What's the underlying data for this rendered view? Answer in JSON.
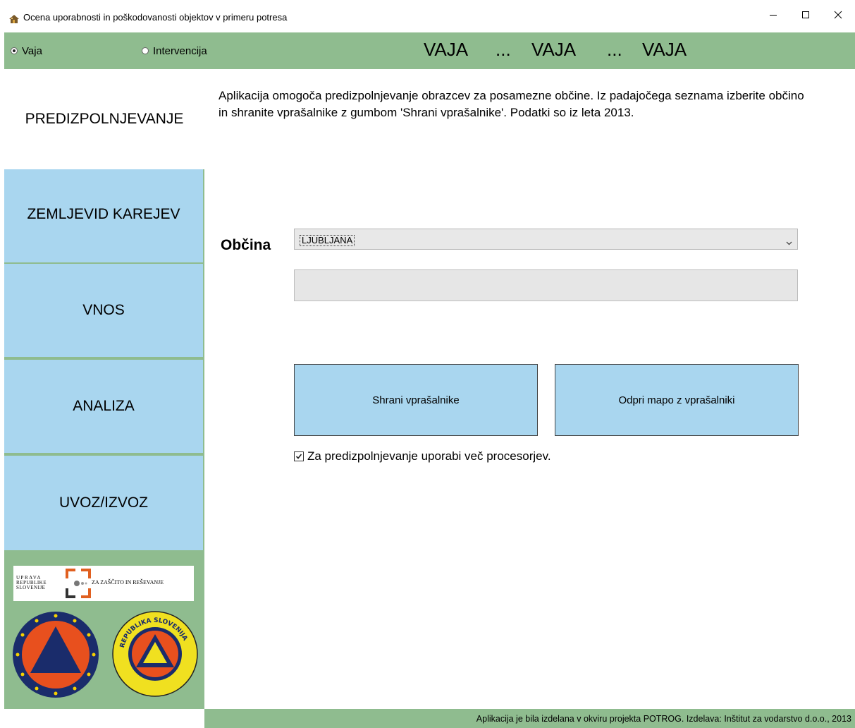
{
  "window": {
    "title": "Ocena uporabnosti in poškodovanosti objektov v primeru potresa",
    "icon": "house-icon",
    "controls": [
      "minimize-icon",
      "maximize-icon",
      "close-icon"
    ]
  },
  "mode": {
    "options": [
      {
        "label": "Vaja",
        "selected": true
      },
      {
        "label": "Intervencija",
        "selected": false
      }
    ],
    "banner": {
      "word": "VAJA",
      "ellipsis": "..."
    }
  },
  "sidebar": {
    "items": [
      {
        "label": "PREDIZPOLNJEVANJE",
        "active": true
      },
      {
        "label": "ZEMLJEVID KAREJEV",
        "active": false
      },
      {
        "label": "VNOS",
        "active": false
      },
      {
        "label": "ANALIZA",
        "active": false
      },
      {
        "label": "UVOZ/IZVOZ",
        "active": false
      }
    ],
    "logo": {
      "line1": "UPRAVA",
      "line2": "REPUBLIKE",
      "line3": "SLOVENIJE",
      "tagline": "ZA ZAŠČITO IN REŠEVANJE"
    },
    "emblem2_text": "REPUBLIKA SLOVENIJA · CIVILNA ZAŠČITA"
  },
  "main": {
    "intro": "Aplikacija omogoča predizpolnjevanje obrazcev za posamezne občine. Iz padajočega seznama izberite občino in shranite vprašalnike z gumbom 'Shrani vprašalnike'. Podatki so iz leta 2013.",
    "municipality_label": "Občina",
    "municipality_value": "LJUBLJANA",
    "progress": 0,
    "save_button": "Shrani vprašalnike",
    "open_button": "Odpri mapo z vprašalniki",
    "multiprocessor_label": "Za predizpolnjevanje uporabi več procesorjev.",
    "multiprocessor_checked": true
  },
  "footer": {
    "text": "Aplikacija je bila izdelana v okviru projekta POTROG. Izdelava: Inštitut za vodarstvo d.o.o., 2013"
  },
  "colors": {
    "green": "#8fbc8f",
    "blue": "#a9d6ef",
    "white": "#ffffff"
  }
}
